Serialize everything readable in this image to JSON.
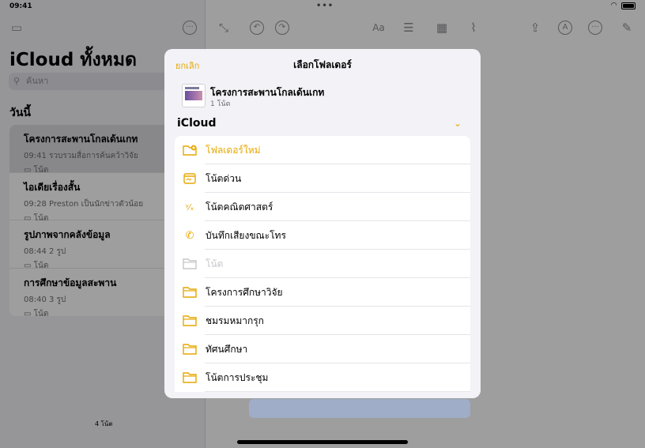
{
  "status": {
    "time": "09:41"
  },
  "sidebar": {
    "title": "iCloud ทั้งหมด",
    "search_placeholder": "ค้นหา",
    "section": "วันนี้",
    "count": "4 โน้ต",
    "notes": [
      {
        "title": "โครงการสะพานโกลเด้นเกท",
        "time": "09:41",
        "preview": "รวบรวมสื่อการค้นคว้าวิจัย",
        "folder": "โน้ต"
      },
      {
        "title": "ไอเดียเรื่องสั้น",
        "time": "09:28",
        "preview": "Preston เป็นนักข่าวตัวน้อย",
        "folder": "โน้ต"
      },
      {
        "title": "รูปภาพจากคลังข้อมูล",
        "time": "08:44",
        "preview": "2 รูป",
        "folder": "โน้ต"
      },
      {
        "title": "การศึกษาข้อมูลสะพาน",
        "time": "08:40",
        "preview": "3 รูป",
        "folder": "โน้ต"
      }
    ]
  },
  "sheet": {
    "cancel_label": "ยกเลิก",
    "title": "เลือกโฟลเดอร์",
    "selected_note_title": "โครงการสะพานโกลเด้นเกท",
    "selected_note_count": "1 โน้ต",
    "account": "iCloud",
    "folders": [
      {
        "label": "โฟลเดอร์ใหม่",
        "icon": "new-folder-icon"
      },
      {
        "label": "โน้ตด่วน",
        "icon": "quick-note-icon"
      },
      {
        "label": "โน้ตคณิตศาสตร์",
        "icon": "math-icon"
      },
      {
        "label": "บันทึกเสียงขณะโทร",
        "icon": "phone-icon"
      },
      {
        "label": "โน้ต",
        "icon": "folder-icon"
      },
      {
        "label": "โครงการศึกษาวิจัย",
        "icon": "folder-icon"
      },
      {
        "label": "ชมรมหมากรุก",
        "icon": "folder-icon"
      },
      {
        "label": "ทัศนศึกษา",
        "icon": "folder-icon"
      },
      {
        "label": "โน้ตการประชุม",
        "icon": "folder-icon"
      }
    ]
  },
  "colors": {
    "accent": "#e6a700"
  }
}
